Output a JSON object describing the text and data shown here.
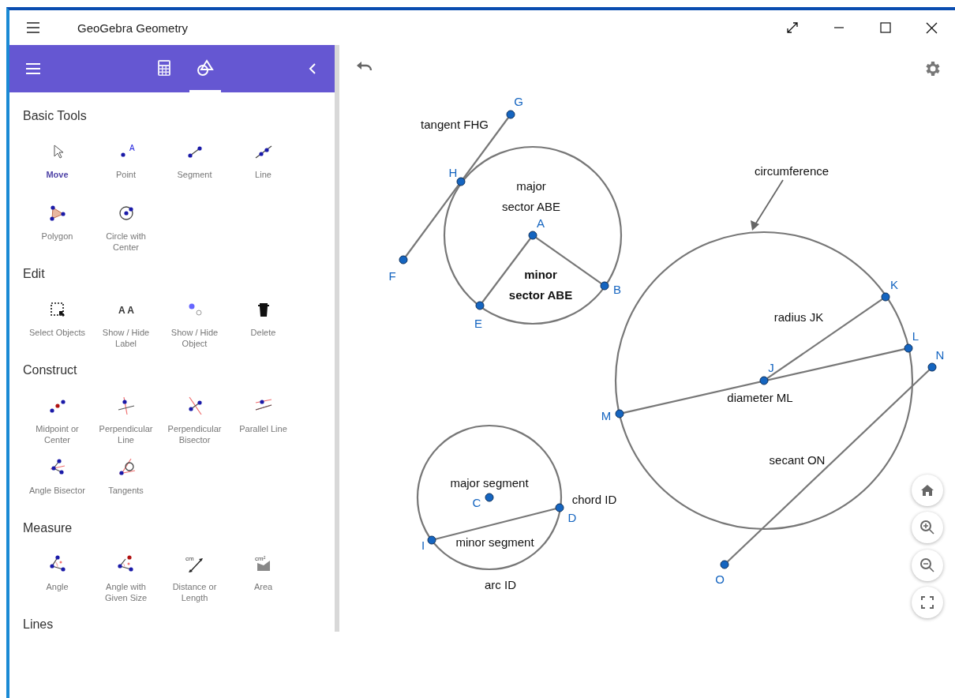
{
  "window": {
    "title": "GeoGebra Geometry"
  },
  "sidebar": {
    "tabs": [
      {
        "kind": "calculator",
        "selected": false
      },
      {
        "kind": "tools",
        "selected": true
      }
    ],
    "sections": [
      {
        "title": "Basic Tools",
        "tools": [
          {
            "kind": "move",
            "label": "Move",
            "selected": true
          },
          {
            "kind": "point",
            "label": "Point",
            "icon_text": "A",
            "selected": false
          },
          {
            "kind": "segment",
            "label": "Segment",
            "selected": false
          },
          {
            "kind": "line",
            "label": "Line",
            "selected": false
          },
          {
            "kind": "polygon",
            "label": "Polygon",
            "selected": false
          },
          {
            "kind": "circle",
            "label": "Circle with Center",
            "selected": false
          }
        ]
      },
      {
        "title": "Edit",
        "tools": [
          {
            "kind": "select",
            "label": "Select Objects",
            "selected": false
          },
          {
            "kind": "label",
            "label": "Show / Hide Label",
            "icon_text": "AA",
            "selected": false
          },
          {
            "kind": "object",
            "label": "Show / Hide Object",
            "selected": false
          },
          {
            "kind": "delete",
            "label": "Delete",
            "selected": false
          }
        ]
      },
      {
        "title": "Construct",
        "tools": [
          {
            "kind": "midpoint",
            "label": "Midpoint or Center",
            "selected": false
          },
          {
            "kind": "perpendicular",
            "label": "Perpendicular Line",
            "selected": false
          },
          {
            "kind": "bisector",
            "label": "Perpendicular Bisector",
            "selected": false
          },
          {
            "kind": "parallel",
            "label": "Parallel Line",
            "selected": false
          },
          {
            "kind": "anglebisector",
            "label": "Angle Bisector",
            "selected": false
          },
          {
            "kind": "tangents",
            "label": "Tangents",
            "selected": false
          }
        ]
      },
      {
        "title": "Measure",
        "tools": [
          {
            "kind": "angle",
            "label": "Angle",
            "selected": false
          },
          {
            "kind": "anglesize",
            "label": "Angle with Given Size",
            "selected": false
          },
          {
            "kind": "distance",
            "label": "Distance or Length",
            "icon_text": "cm",
            "selected": false
          },
          {
            "kind": "area",
            "label": "Area",
            "icon_text": "cm²",
            "selected": false
          }
        ]
      },
      {
        "title": "Lines"
      }
    ]
  },
  "canvas": {
    "points": [
      {
        "label": "G"
      },
      {
        "label": "H"
      },
      {
        "label": "A"
      },
      {
        "label": "F"
      },
      {
        "label": "B"
      },
      {
        "label": "K"
      },
      {
        "label": "E"
      },
      {
        "label": "L"
      },
      {
        "label": "N"
      },
      {
        "label": "J"
      },
      {
        "label": "M"
      },
      {
        "label": "C"
      },
      {
        "label": "D"
      },
      {
        "label": "I"
      },
      {
        "label": "O"
      }
    ],
    "annotations": [
      {
        "lines": [
          "tangent FHG"
        ],
        "bold": false
      },
      {
        "lines": [
          "circumference"
        ],
        "bold": false
      },
      {
        "lines": [
          "major",
          "sector ABE"
        ],
        "bold": false
      },
      {
        "lines": [
          "minor",
          "sector ABE"
        ],
        "bold": true
      },
      {
        "lines": [
          "radius JK"
        ],
        "bold": false
      },
      {
        "lines": [
          "diameter ML"
        ],
        "bold": false
      },
      {
        "lines": [
          "secant ON"
        ],
        "bold": false
      },
      {
        "lines": [
          "major segment"
        ],
        "bold": false
      },
      {
        "lines": [
          "chord ID"
        ],
        "bold": false
      },
      {
        "lines": [
          "minor segment"
        ],
        "bold": false
      },
      {
        "lines": [
          "arc ID"
        ],
        "bold": false
      }
    ]
  }
}
